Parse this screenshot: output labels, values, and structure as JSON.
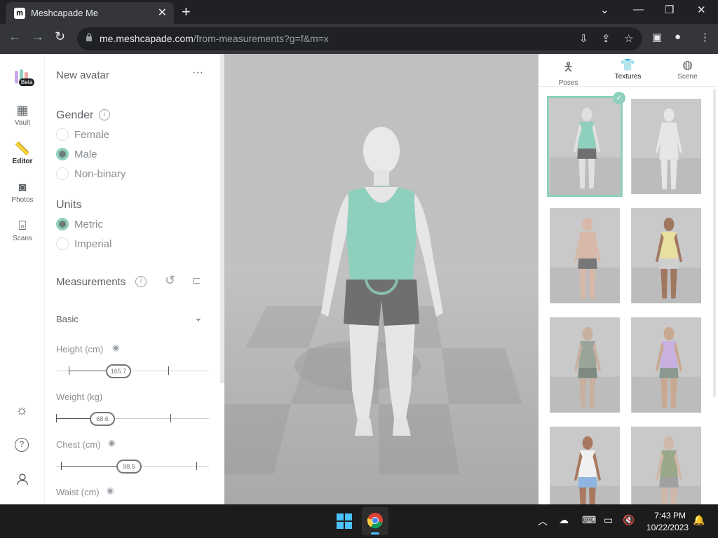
{
  "browser": {
    "tab_title": "Meshcapade Me",
    "favicon_letter": "m",
    "url_host": "me.meshcapade.com",
    "url_path": "/from-measurements?g=f&m=x"
  },
  "rail": {
    "beta_badge": "Beta",
    "items": [
      {
        "label": "Vault",
        "icon": "grid-icon"
      },
      {
        "label": "Editor",
        "icon": "ruler-icon"
      },
      {
        "label": "Photos",
        "icon": "camera-icon"
      },
      {
        "label": "Scans",
        "icon": "scan-icon"
      }
    ]
  },
  "panel": {
    "title": "New avatar",
    "more": "···",
    "gender_label": "Gender",
    "gender_options": [
      "Female",
      "Male",
      "Non-binary"
    ],
    "gender_selected": "Male",
    "units_label": "Units",
    "units_options": [
      "Metric",
      "Imperial"
    ],
    "units_selected": "Metric",
    "measurements_label": "Measurements",
    "basic_label": "Basic",
    "sliders": [
      {
        "label": "Height (cm)",
        "value": "165.7",
        "fraction": 0.35
      },
      {
        "label": "Weight (kg)",
        "value": "68.6",
        "fraction": 0.33
      },
      {
        "label": "Chest (cm)",
        "value": "98.5",
        "fraction": 0.5
      },
      {
        "label": "Waist (cm)",
        "value": ""
      }
    ]
  },
  "right_tabs": [
    {
      "label": "Poses",
      "icon": "pose-icon"
    },
    {
      "label": "Textures",
      "icon": "shirt-icon"
    },
    {
      "label": "Scene",
      "icon": "palette-icon"
    }
  ],
  "textures_selected_index": 0,
  "taskbar": {
    "time": "7:43 PM",
    "date": "10/22/2023"
  },
  "colors": {
    "accent": "#8fcfbd",
    "chrome_dark": "#202124",
    "chrome_mid": "#35363a",
    "viewport_bg": "#bdbdbd"
  }
}
